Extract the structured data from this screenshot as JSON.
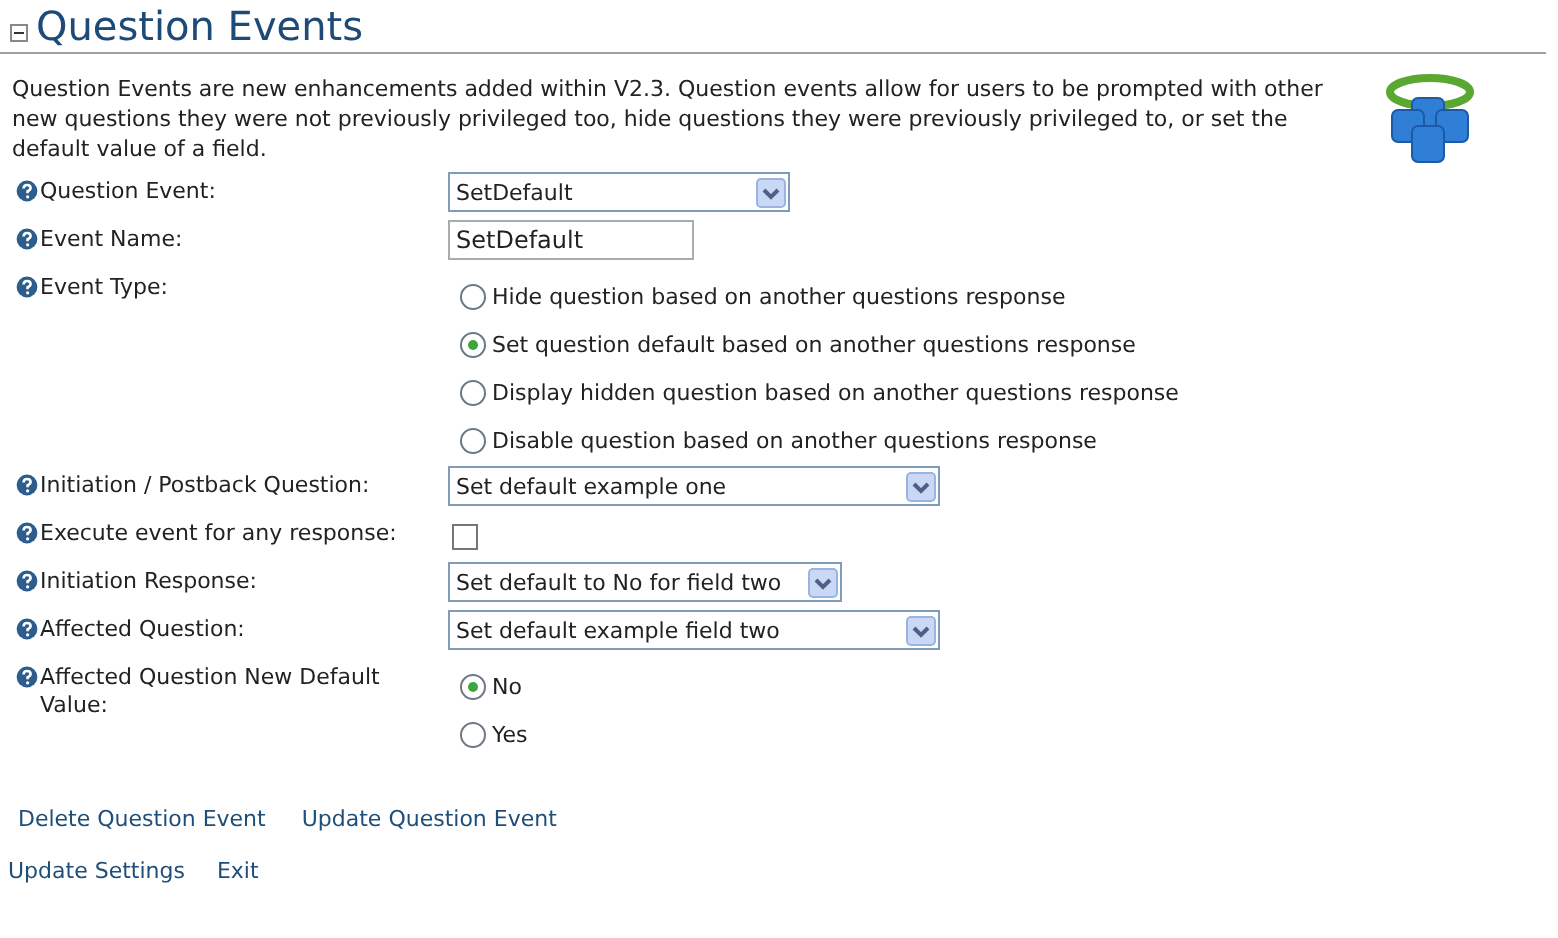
{
  "header": {
    "title": "Question Events",
    "expanded": true
  },
  "intro": "Question Events are new enhancements added within V2.3. Question events allow for users to be prompted with other new questions they were not previously privileged too, hide questions they were previously privileged to, or set the default value of a field.",
  "fields": [
    {
      "kind": "select",
      "label": "Question Event:",
      "value": "SetDefault"
    },
    {
      "kind": "text",
      "label": "Event Name:",
      "value": "SetDefault"
    },
    {
      "kind": "radio",
      "label": "Event Type:",
      "options": [
        {
          "label": "Hide question based on another questions response",
          "selected": false
        },
        {
          "label": "Set question default based on another questions response",
          "selected": true
        },
        {
          "label": "Display hidden question based on another questions response",
          "selected": false
        },
        {
          "label": "Disable question based on another questions response",
          "selected": false
        }
      ]
    },
    {
      "kind": "select",
      "label": "Initiation / Postback Question:",
      "value": "Set default example one"
    },
    {
      "kind": "checkbox",
      "label": "Execute event for any response:",
      "checked": false
    },
    {
      "kind": "select",
      "label": "Initiation Response:",
      "value": "Set default to No for field two"
    },
    {
      "kind": "select",
      "label": "Affected Question:",
      "value": "Set default example field two"
    },
    {
      "kind": "radio",
      "label": "Affected Question New Default Value:",
      "options": [
        {
          "label": "No",
          "selected": true
        },
        {
          "label": "Yes",
          "selected": false
        }
      ]
    }
  ],
  "actions": [
    "Delete Question Event",
    "Update Question Event"
  ],
  "footer_links": [
    "Update Settings",
    "Exit"
  ]
}
